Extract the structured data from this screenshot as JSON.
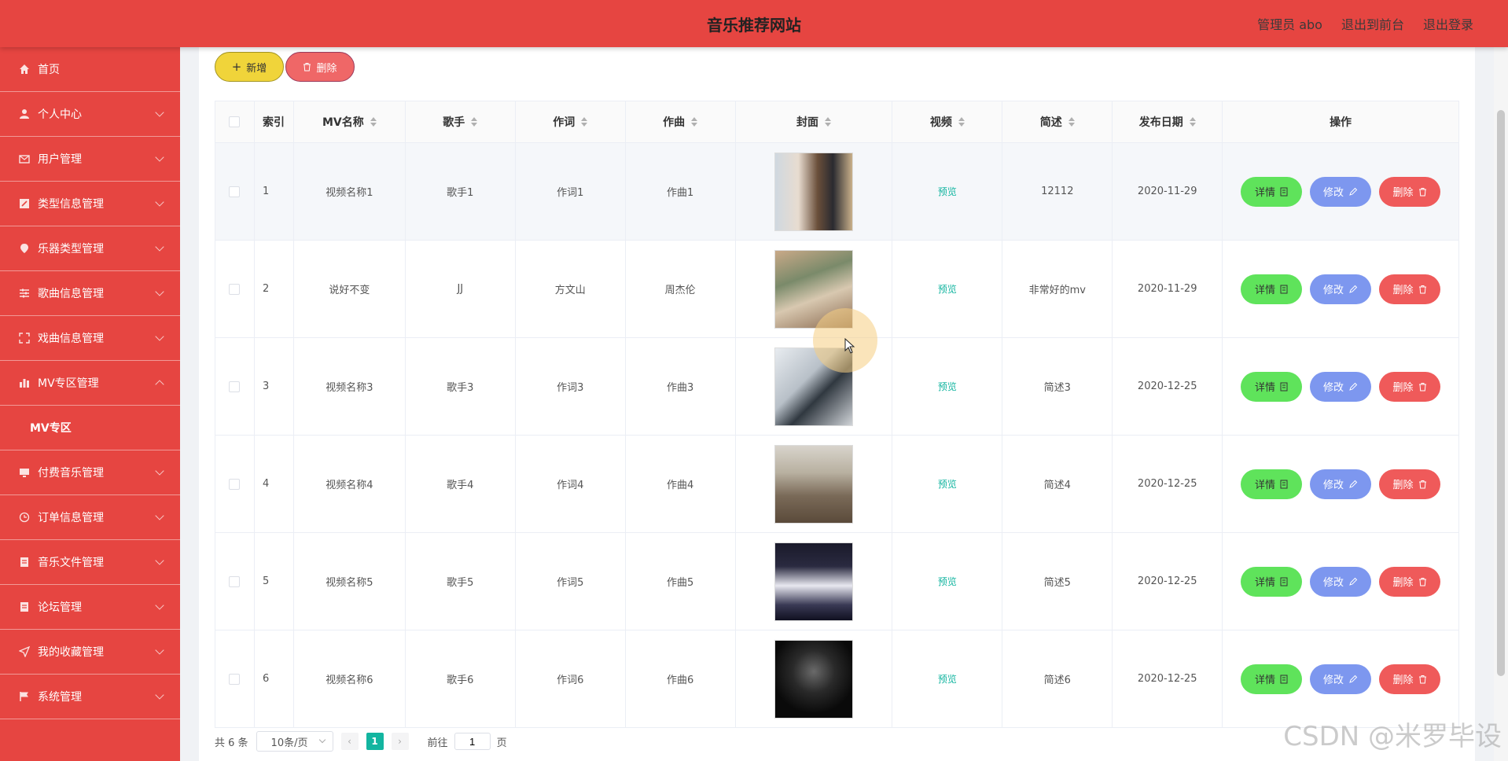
{
  "header": {
    "title": "音乐推荐网站",
    "user_label": "管理员 abo",
    "front_link": "退出到前台",
    "logout_link": "退出登录"
  },
  "sidebar": {
    "items": [
      {
        "label": "首页",
        "icon": "home-icon"
      },
      {
        "label": "个人中心",
        "icon": "user-icon"
      },
      {
        "label": "用户管理",
        "icon": "mail-icon"
      },
      {
        "label": "类型信息管理",
        "icon": "edit-icon"
      },
      {
        "label": "乐器类型管理",
        "icon": "location-icon"
      },
      {
        "label": "歌曲信息管理",
        "icon": "sliders-icon"
      },
      {
        "label": "戏曲信息管理",
        "icon": "fullscreen-icon"
      },
      {
        "label": "MV专区管理",
        "icon": "chart-icon"
      },
      {
        "label": "付费音乐管理",
        "icon": "monitor-icon"
      },
      {
        "label": "订单信息管理",
        "icon": "clock-icon"
      },
      {
        "label": "音乐文件管理",
        "icon": "document-icon"
      },
      {
        "label": "论坛管理",
        "icon": "document-icon"
      },
      {
        "label": "我的收藏管理",
        "icon": "send-icon"
      },
      {
        "label": "系统管理",
        "icon": "flag-icon"
      }
    ],
    "submenu": "MV专区"
  },
  "toolbar": {
    "add_label": "新增",
    "delete_label": "删除"
  },
  "table": {
    "headers": [
      "索引",
      "MV名称",
      "歌手",
      "作词",
      "作曲",
      "封面",
      "视频",
      "简述",
      "发布日期",
      "操作"
    ],
    "rows": [
      {
        "idx": "1",
        "name": "视频名称1",
        "singer": "歌手1",
        "lyric": "作词1",
        "composer": "作曲1",
        "video": "预览",
        "desc": "12112",
        "date": "2020-11-29"
      },
      {
        "idx": "2",
        "name": "说好不变",
        "singer": "JJ",
        "lyric": "方文山",
        "composer": "周杰伦",
        "video": "预览",
        "desc": "非常好的mv",
        "date": "2020-11-29"
      },
      {
        "idx": "3",
        "name": "视频名称3",
        "singer": "歌手3",
        "lyric": "作词3",
        "composer": "作曲3",
        "video": "预览",
        "desc": "简述3",
        "date": "2020-12-25"
      },
      {
        "idx": "4",
        "name": "视频名称4",
        "singer": "歌手4",
        "lyric": "作词4",
        "composer": "作曲4",
        "video": "预览",
        "desc": "简述4",
        "date": "2020-12-25"
      },
      {
        "idx": "5",
        "name": "视频名称5",
        "singer": "歌手5",
        "lyric": "作词5",
        "composer": "作曲5",
        "video": "预览",
        "desc": "简述5",
        "date": "2020-12-25"
      },
      {
        "idx": "6",
        "name": "视频名称6",
        "singer": "歌手6",
        "lyric": "作词6",
        "composer": "作曲6",
        "video": "预览",
        "desc": "简述6",
        "date": "2020-12-25"
      }
    ],
    "actions": {
      "detail": "详情",
      "edit": "修改",
      "delete": "删除"
    }
  },
  "pagination": {
    "total": "共 6 条",
    "page_size": "10条/页",
    "current": "1",
    "goto_label": "前往",
    "goto_value": "1",
    "page_unit": "页"
  },
  "watermark": "CSDN @米罗毕设",
  "colors": {
    "primary": "#e64541",
    "accent": "#13b5a0"
  }
}
